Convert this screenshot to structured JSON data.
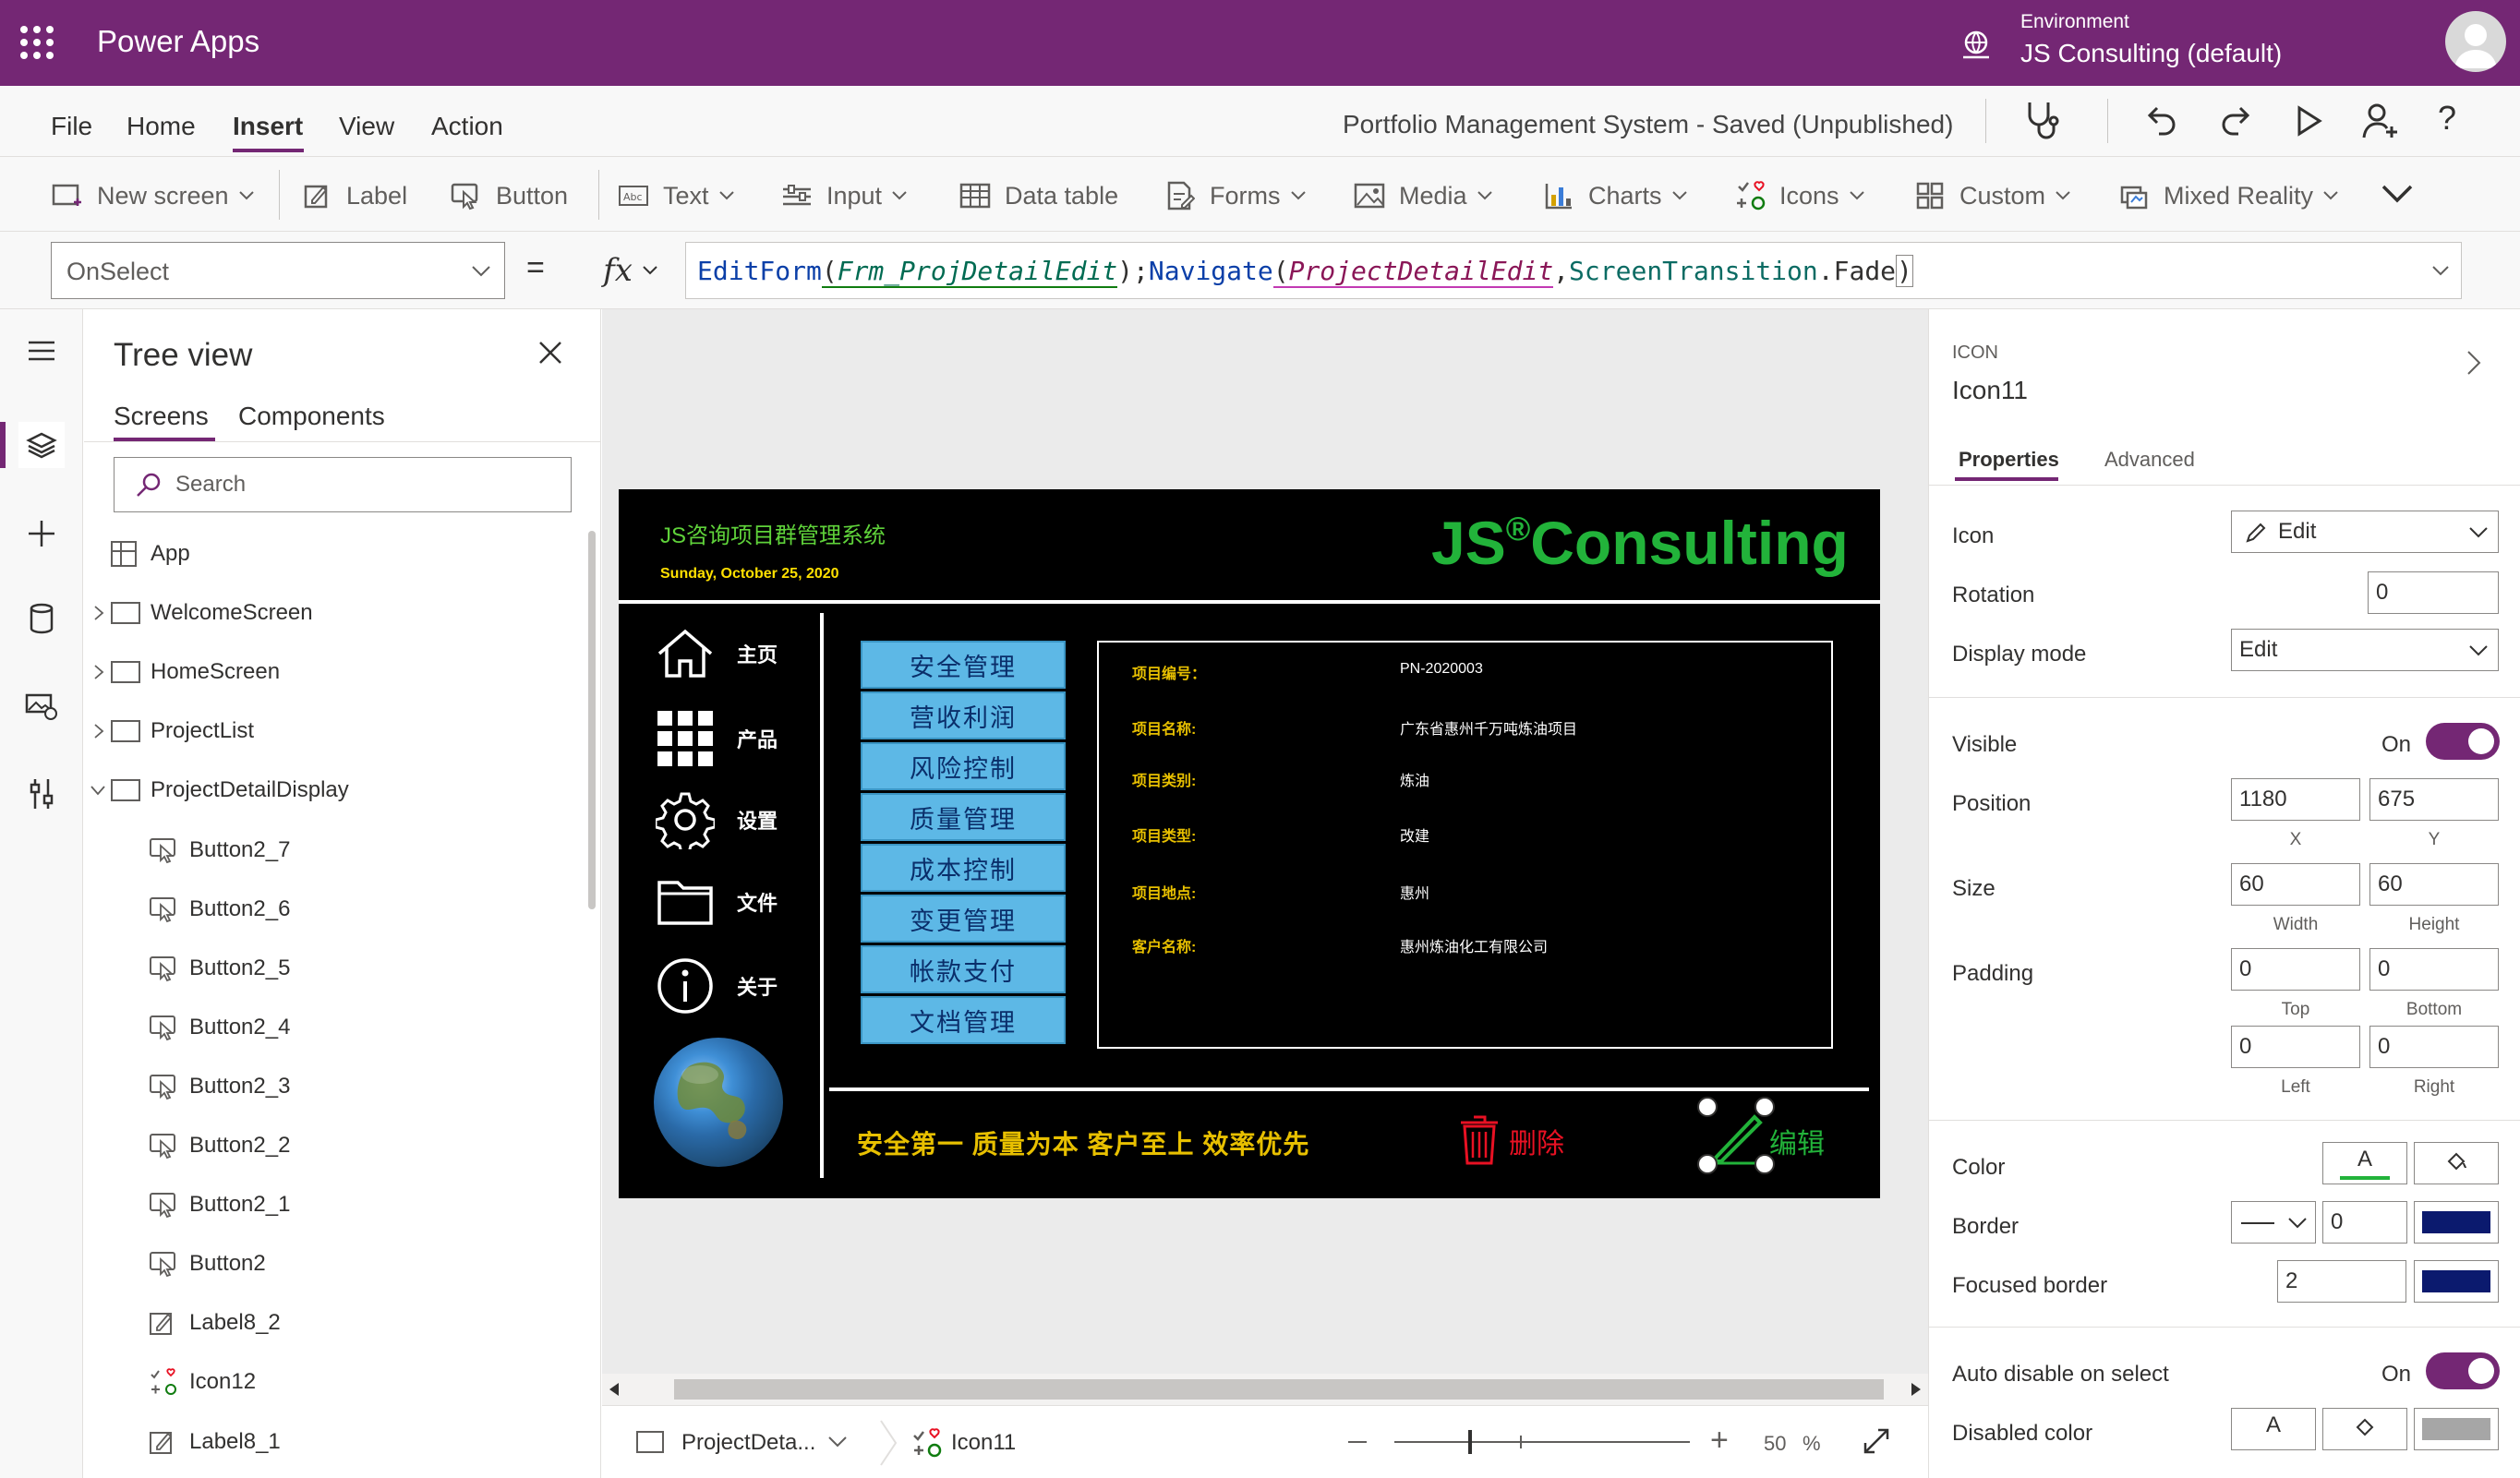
{
  "topbar": {
    "app_name": "Power Apps",
    "environment_label": "Environment",
    "environment_name": "JS Consulting (default)"
  },
  "menu": {
    "items": [
      "File",
      "Home",
      "Insert",
      "View",
      "Action"
    ],
    "active": "Insert",
    "doc_title": "Portfolio Management System - Saved (Unpublished)"
  },
  "ribbon": {
    "new_screen": "New screen",
    "label": "Label",
    "button": "Button",
    "text": "Text",
    "input": "Input",
    "data_table": "Data table",
    "forms": "Forms",
    "media": "Media",
    "charts": "Charts",
    "icons": "Icons",
    "custom": "Custom",
    "mixed_reality": "Mixed Reality"
  },
  "formula_bar": {
    "property": "OnSelect",
    "equals": "=",
    "fx": "fx",
    "formula_parts": {
      "fn1": "EditForm",
      "arg1": "Frm_ProjDetailEdit",
      "sep": ");",
      "fn2": "Navigate",
      "arg2": "ProjectDetailEdit",
      "comma": ",",
      "arg3": "ScreenTransition",
      "dot": ".Fade"
    }
  },
  "tree": {
    "title": "Tree view",
    "tabs": [
      "Screens",
      "Components"
    ],
    "search_placeholder": "Search",
    "items": [
      {
        "label": "App",
        "type": "app"
      },
      {
        "label": "WelcomeScreen",
        "type": "screen"
      },
      {
        "label": "HomeScreen",
        "type": "screen"
      },
      {
        "label": "ProjectList",
        "type": "screen"
      },
      {
        "label": "ProjectDetailDisplay",
        "type": "screen"
      },
      {
        "label": "Button2_7",
        "type": "button"
      },
      {
        "label": "Button2_6",
        "type": "button"
      },
      {
        "label": "Button2_5",
        "type": "button"
      },
      {
        "label": "Button2_4",
        "type": "button"
      },
      {
        "label": "Button2_3",
        "type": "button"
      },
      {
        "label": "Button2_2",
        "type": "button"
      },
      {
        "label": "Button2_1",
        "type": "button"
      },
      {
        "label": "Button2",
        "type": "button"
      },
      {
        "label": "Label8_2",
        "type": "label"
      },
      {
        "label": "Icon12",
        "type": "icon"
      },
      {
        "label": "Label8_1",
        "type": "label"
      }
    ]
  },
  "screen": {
    "title": "JS咨询项目群管理系统",
    "date": "Sunday, October 25, 2020",
    "logo_main": "JS",
    "logo_reg": "®",
    "logo_rest": "Consulting",
    "nav": [
      "主页",
      "产品",
      "设置",
      "文件",
      "关于"
    ],
    "menu_buttons": [
      "安全管理",
      "营收利润",
      "风险控制",
      "质量管理",
      "成本控制",
      "变更管理",
      "帐款支付",
      "文档管理"
    ],
    "details": [
      {
        "label": "项目编号：",
        "value": "PN-2020003"
      },
      {
        "label": "项目名称:",
        "value": "广东省惠州千万吨炼油项目"
      },
      {
        "label": "项目类别:",
        "value": "炼油"
      },
      {
        "label": "项目类型:",
        "value": "改建"
      },
      {
        "label": "项目地点:",
        "value": "惠州"
      },
      {
        "label": "客户名称:",
        "value": "惠州炼油化工有限公司"
      }
    ],
    "slogan": "安全第一  质量为本  客户至上  效率优先",
    "delete_label": "删除",
    "edit_label": "编辑"
  },
  "statusbar": {
    "screen_name": "ProjectDeta...",
    "control_name": "Icon11",
    "zoom_value": "50",
    "zoom_unit": "%"
  },
  "props": {
    "type": "ICON",
    "name": "Icon11",
    "tabs": [
      "Properties",
      "Advanced"
    ],
    "icon_label": "Icon",
    "icon_value": "Edit",
    "rotation_label": "Rotation",
    "rotation_value": "0",
    "display_mode_label": "Display mode",
    "display_mode_value": "Edit",
    "visible_label": "Visible",
    "visible_state": "On",
    "position_label": "Position",
    "x": "1180",
    "y": "675",
    "x_sub": "X",
    "y_sub": "Y",
    "size_label": "Size",
    "width": "60",
    "height": "60",
    "width_sub": "Width",
    "height_sub": "Height",
    "padding_label": "Padding",
    "pad_top": "0",
    "pad_bottom": "0",
    "pad_left": "0",
    "pad_right": "0",
    "top_sub": "Top",
    "bottom_sub": "Bottom",
    "left_sub": "Left",
    "right_sub": "Right",
    "color_label": "Color",
    "color_glyph": "A",
    "border_label": "Border",
    "border_value": "0",
    "focused_border_label": "Focused border",
    "focused_border_value": "2",
    "auto_disable_label": "Auto disable on select",
    "auto_disable_state": "On",
    "disabled_color_label": "Disabled color",
    "border_color": "#0b1a6e",
    "accent": "#742774"
  }
}
